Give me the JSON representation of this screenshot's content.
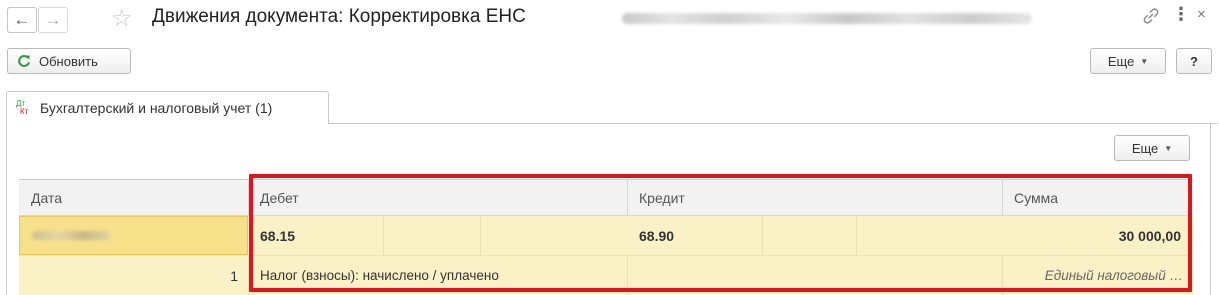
{
  "window": {
    "title": "Движения документа: Корректировка ЕНС",
    "icons": [
      "arrow-left-icon",
      "arrow-right-icon",
      "star-icon",
      "link-icon",
      "more-icon",
      "close-icon"
    ]
  },
  "toolbar": {
    "refresh_label": "Обновить",
    "more_label": "Еще",
    "help_label": "?"
  },
  "tab": {
    "label": "Бухгалтерский и налоговый учет (1)",
    "icon_top": "Дт",
    "icon_bottom": "Кт"
  },
  "table": {
    "more_label": "Еще",
    "headers": {
      "date": "Дата",
      "debit": "Дебет",
      "credit": "Кредит",
      "amount": "Сумма"
    },
    "rows": [
      {
        "row_number": "1",
        "debit_account": "68.15",
        "credit_account": "68.90",
        "amount": "30 000,00",
        "debit_subconto": "Налог (взносы): начислено / уплачено",
        "amount_comment": "Единый налоговый …"
      }
    ]
  },
  "colors": {
    "highlight_frame": "#e0151b",
    "selected_row": "#fbf1c7",
    "refresh_icon": "#2e9a3c"
  }
}
